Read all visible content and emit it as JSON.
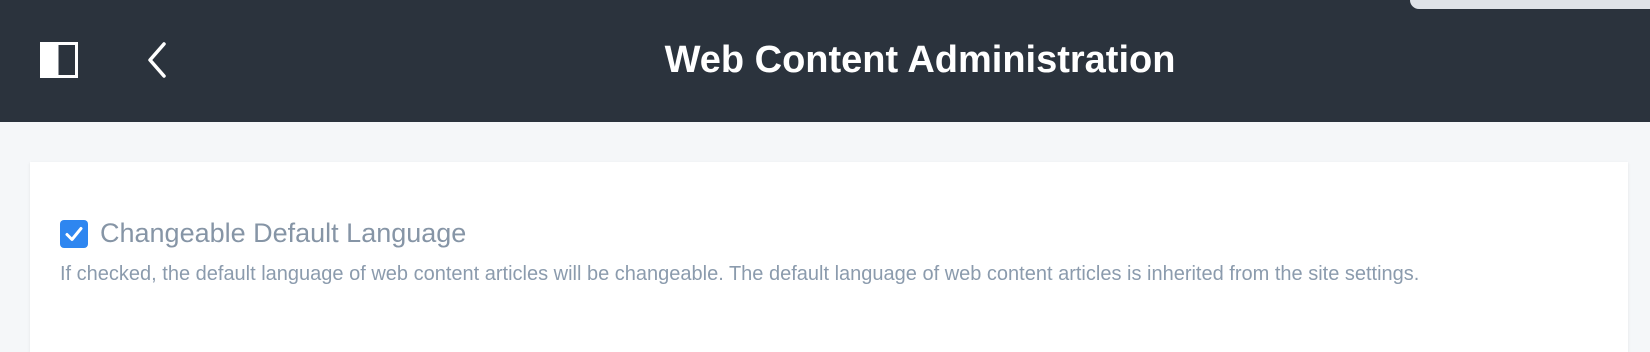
{
  "header": {
    "title": "Web Content Administration",
    "toggle_icon": "sidebar-toggle-icon",
    "back_icon": "chevron-left-icon",
    "background_color": "#2b333d"
  },
  "settings": {
    "changeable_default_language": {
      "label": "Changeable Default Language",
      "checked": true,
      "description": "If checked, the default language of web content articles will be changeable. The default language of web content articles is inherited from the site settings.",
      "check_icon": "checkmark-icon",
      "accent_color": "#2e86f0"
    }
  }
}
